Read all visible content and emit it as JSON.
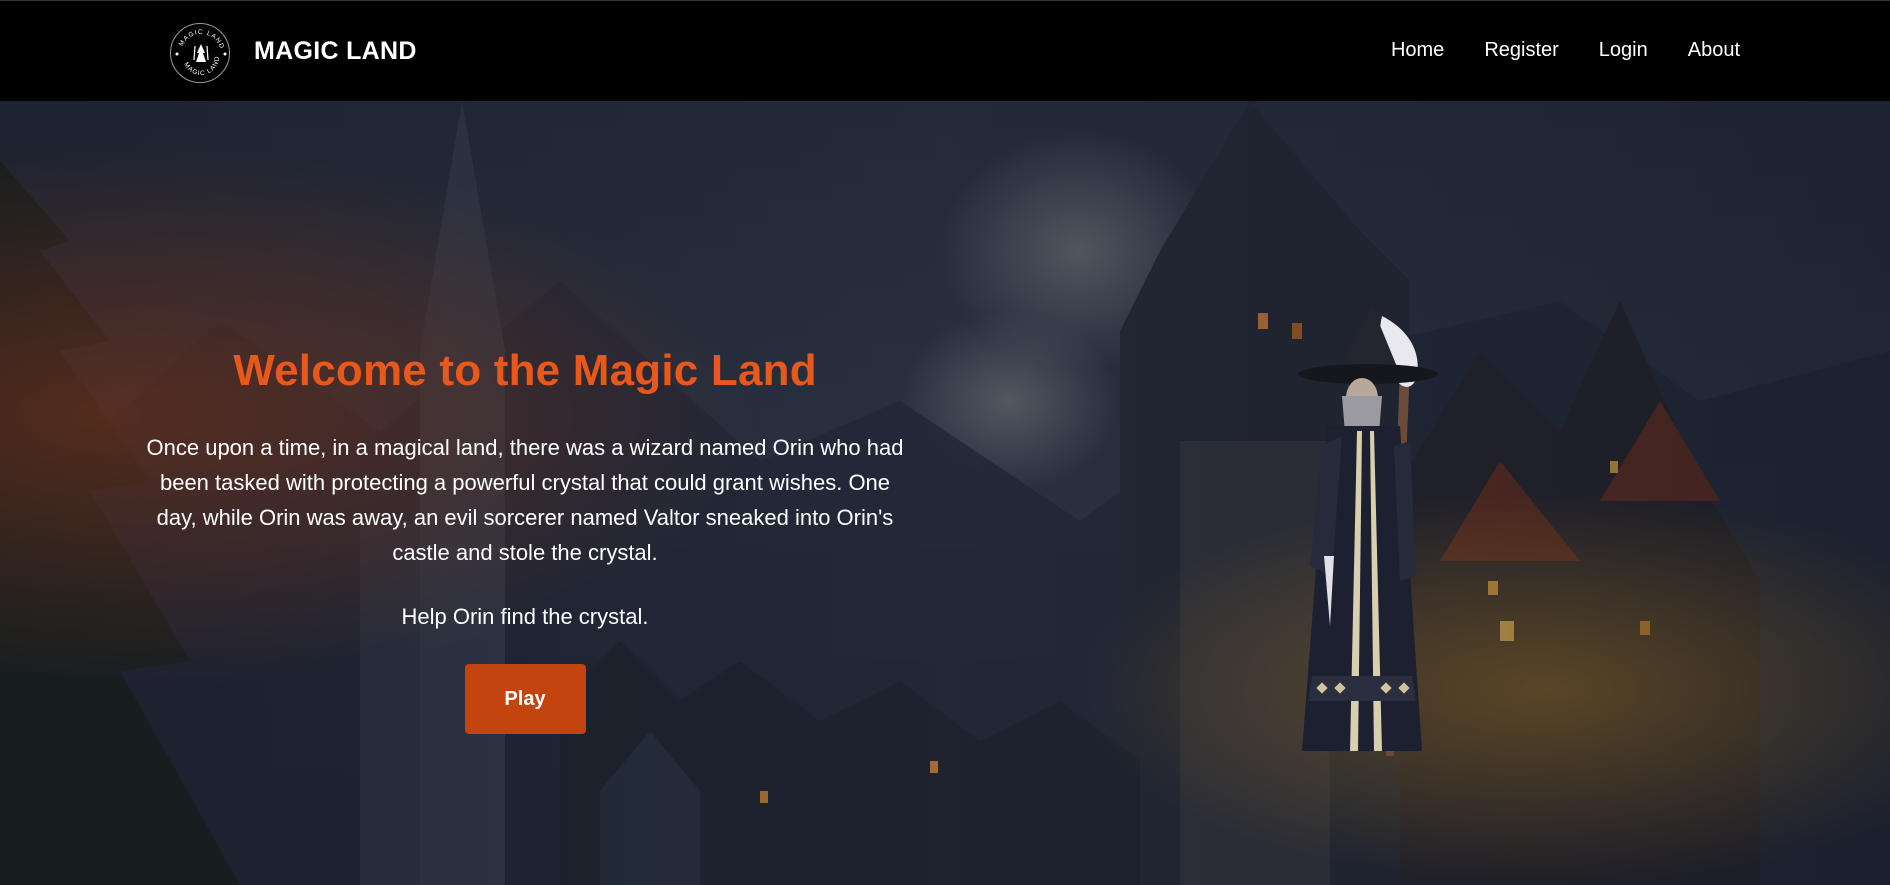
{
  "header": {
    "logo": {
      "icon": "wizard-emblem-icon",
      "ring_text": "MAGIC LAND"
    },
    "brand": "MAGIC LAND",
    "nav": [
      {
        "label": "Home"
      },
      {
        "label": "Register"
      },
      {
        "label": "Login"
      },
      {
        "label": "About"
      }
    ]
  },
  "hero": {
    "title": "Welcome to the Magic Land",
    "story": "Once upon a time, in a magical land, there was a wizard named Orin who had been tasked with protecting a powerful crystal that could grant wishes. One day, while Orin was away, an evil sorcerer named Valtor sneaked into Orin's castle and stole the crystal.",
    "cta_text": "Help Orin find the crystal.",
    "play_label": "Play",
    "background": "fantasy-castle-illustration",
    "character": "wizard-illustration"
  },
  "colors": {
    "accent": "#e8581a",
    "button": "#c4440f",
    "navbar": "#000000",
    "text": "#ffffff"
  }
}
